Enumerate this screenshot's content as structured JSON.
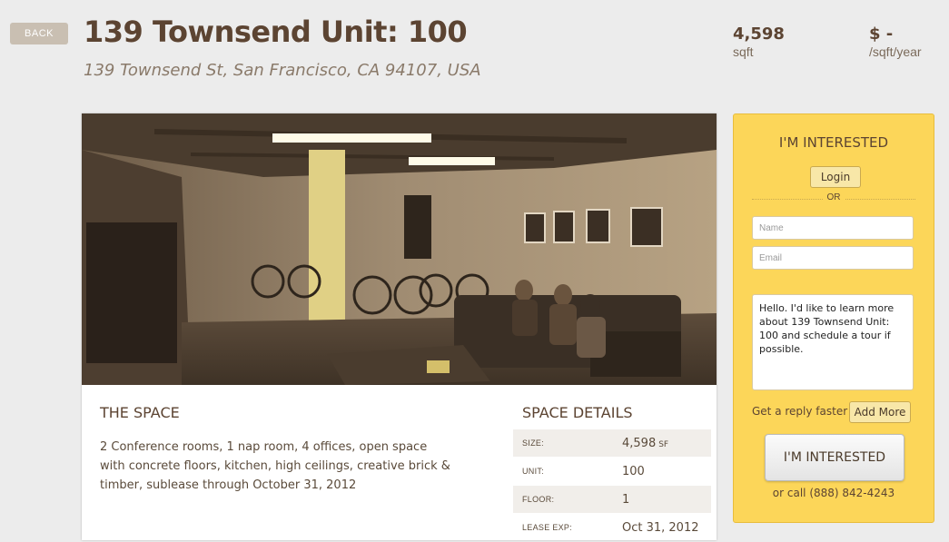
{
  "nav": {
    "back_label": "BACK"
  },
  "listing": {
    "title": "139 Townsend Unit: 100",
    "address": "139 Townsend St, San Francisco, CA 94107, USA",
    "area_value": "4,598",
    "area_unit": "sqft",
    "price_value": "$ -",
    "price_unit": "/sqft/year"
  },
  "space": {
    "title": "THE SPACE",
    "description": "2 Conference rooms, 1 nap room, 4 offices, open space with concrete floors, kitchen, high ceilings, creative brick & timber, sublease through October 31, 2012"
  },
  "details": {
    "title": "SPACE DETAILS",
    "rows": [
      {
        "label": "SIZE:",
        "value": "4,598",
        "unit": "SF"
      },
      {
        "label": "UNIT:",
        "value": "100",
        "unit": ""
      },
      {
        "label": "FLOOR:",
        "value": "1",
        "unit": ""
      },
      {
        "label": "LEASE EXP:",
        "value": "Oct 31, 2012",
        "unit": ""
      }
    ]
  },
  "interest": {
    "title": "I'M INTERESTED",
    "login_label": "Login",
    "or_label": "OR",
    "name_placeholder": "Name",
    "email_placeholder": "Email",
    "message": "Hello. I'd like to learn more about 139 Townsend Unit: 100 and schedule a tour if possible.",
    "reply_text": "Get a reply faster",
    "add_more_label": "Add More",
    "button_label": "I'M INTERESTED",
    "call_text": "or call (888) 842-4243"
  },
  "colors": {
    "background": "#ececec",
    "brand_brown": "#5c4432",
    "interest_yellow": "#fcd659",
    "back_button": "#c9bfb2"
  }
}
